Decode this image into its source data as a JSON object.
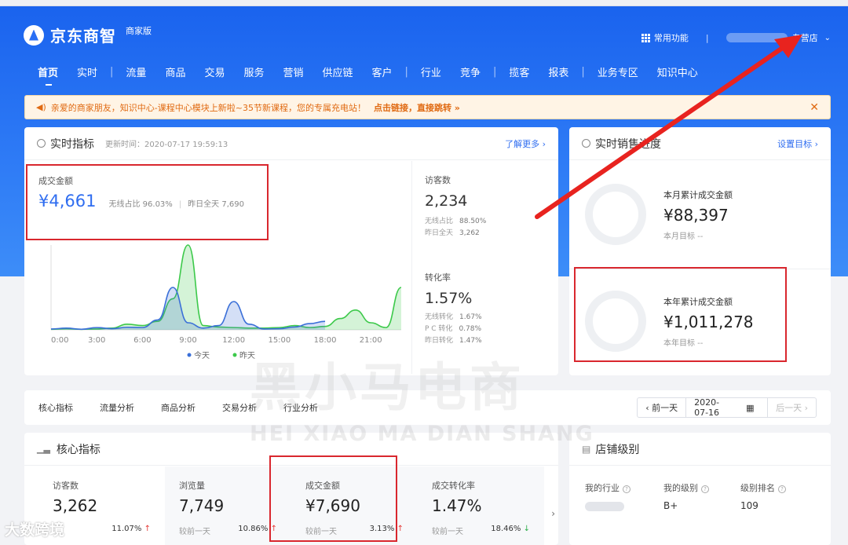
{
  "header": {
    "logo_text": "京东商智",
    "logo_sub": "商家版",
    "common_functions": "常用功能",
    "divider": "|",
    "store_type": "专营店"
  },
  "nav": [
    "首页",
    "实时",
    "流量",
    "商品",
    "交易",
    "服务",
    "营销",
    "供应链",
    "客户",
    "行业",
    "竞争",
    "揽客",
    "报表",
    "业务专区",
    "知识中心"
  ],
  "notice": {
    "text": "亲爱的商家朋友，知识中心-课程中心模块上新啦~35节新课程，您的专属充电站！",
    "link": "点击链接，直接跳转 »"
  },
  "realtime": {
    "title": "实时指标",
    "updated": "更新时间：2020-07-17 19:59:13",
    "more": "了解更多 ›",
    "gmv_label": "成交金额",
    "gmv_value": "¥4,661",
    "wireless_ratio": "无线占比  96.03%",
    "yesterday_total": "昨日全天  7,690",
    "visitors_label": "访客数",
    "visitors_value": "2,234",
    "visitors_wireless_label": "无线占比",
    "visitors_wireless": "88.50%",
    "visitors_yesterday_label": "昨日全天",
    "visitors_yesterday": "3,262",
    "conv_label": "转化率",
    "conv_value": "1.57%",
    "conv_wireless_label": "无线转化",
    "conv_wireless": "1.67%",
    "conv_pc_label": "P C 转化",
    "conv_pc": "0.78%",
    "conv_yesterday_label": "昨日转化",
    "conv_yesterday": "1.47%"
  },
  "chart_data": {
    "type": "area",
    "categories": [
      "0:00",
      "3:00",
      "6:00",
      "9:00",
      "12:00",
      "15:00",
      "18:00",
      "21:00"
    ],
    "x": [
      0,
      1,
      2,
      3,
      4,
      5,
      6,
      7,
      8,
      9,
      10,
      11,
      12,
      13,
      14,
      15,
      16,
      17,
      18,
      19,
      20,
      21,
      22,
      23
    ],
    "series": [
      {
        "name": "今天",
        "color": "#3a6fd8",
        "values": [
          30,
          60,
          20,
          80,
          40,
          90,
          80,
          350,
          1500,
          250,
          60,
          150,
          1000,
          200,
          30,
          40,
          100,
          220,
          300,
          null,
          null,
          null,
          null,
          null
        ]
      },
      {
        "name": "昨天",
        "color": "#3cc94a",
        "values": [
          20,
          40,
          20,
          30,
          60,
          200,
          150,
          300,
          1100,
          3000,
          150,
          100,
          80,
          60,
          60,
          80,
          150,
          80,
          120,
          400,
          700,
          250,
          80,
          1500
        ]
      }
    ],
    "legend": "bottom",
    "grid": false
  },
  "sales_progress": {
    "title": "实时销售进度",
    "set_target": "设置目标 ›",
    "month_label": "本月累计成交金额",
    "month_value": "¥88,397",
    "month_target": "本月目标 --",
    "year_label": "本年累计成交金额",
    "year_value": "¥1,011,278",
    "year_target": "本年目标 --"
  },
  "tabs": [
    "核心指标",
    "流量分析",
    "商品分析",
    "交易分析",
    "行业分析"
  ],
  "date_ctl": {
    "prev": "‹ 前一天",
    "date": "2020-07-16",
    "next": "后一天 ›"
  },
  "core": {
    "title": "核心指标",
    "kpis": [
      {
        "label": "访客数",
        "value": "3,262",
        "cmp": "",
        "pct": "11.07%",
        "dir": "↑"
      },
      {
        "label": "浏览量",
        "value": "7,749",
        "cmp": "较前一天",
        "pct": "10.86%",
        "dir": "↑"
      },
      {
        "label": "成交金额",
        "value": "¥7,690",
        "cmp": "较前一天",
        "pct": "3.13%",
        "dir": "↑"
      },
      {
        "label": "成交转化率",
        "value": "1.47%",
        "cmp": "较前一天",
        "pct": "18.46%",
        "dir": "↓"
      }
    ]
  },
  "shop_level": {
    "title": "店铺级别",
    "industry_label": "我的行业",
    "level_label": "我的级别",
    "level_value": "B+",
    "rank_label": "级别排名",
    "rank_value": "109"
  },
  "watermark": {
    "cn": "黑小马电商",
    "en": "HEI XIAO MA DIAN SHANG",
    "corner": "大数跨境"
  }
}
